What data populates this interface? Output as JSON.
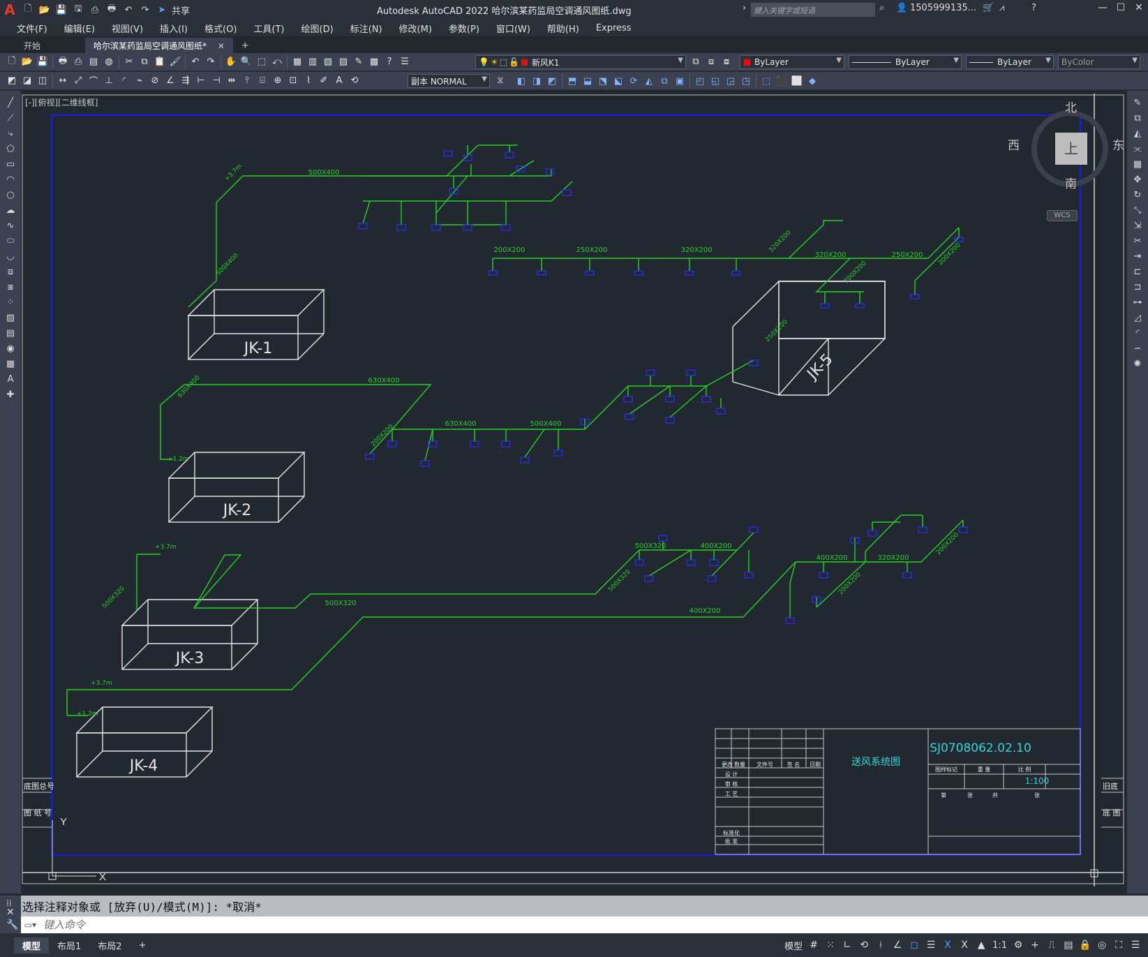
{
  "app": {
    "title": "Autodesk AutoCAD 2022    哈尔滨某药监局空调通风图纸.dwg",
    "share_label": "共享",
    "search_placeholder": "键入关键字或短语",
    "user": "1505999135...",
    "help": "?"
  },
  "menu": [
    "文件(F)",
    "编辑(E)",
    "视图(V)",
    "插入(I)",
    "格式(O)",
    "工具(T)",
    "绘图(D)",
    "标注(N)",
    "修改(M)",
    "参数(P)",
    "窗口(W)",
    "帮助(H)",
    "Express"
  ],
  "tabs": [
    {
      "label": "开始",
      "active": false
    },
    {
      "label": "哈尔滨某药监局空调通风图纸*",
      "active": true
    }
  ],
  "toolbar": {
    "layer_name": "新风K1",
    "color": "ByLayer",
    "linetype": "ByLayer",
    "lineweight": "ByLayer",
    "plotstyle": "ByColor",
    "dimstyle": "副本 NORMAL"
  },
  "viewport": {
    "label": "[-][俯视][二维线框]"
  },
  "viewcube": {
    "north": "北",
    "south": "南",
    "east": "东",
    "west": "西",
    "face": "上",
    "wcs": "WCS"
  },
  "drawing": {
    "units": [
      "JK-1",
      "JK-2",
      "JK-3",
      "JK-4",
      "JK-5"
    ],
    "duct_labels": [
      "500X400",
      "630X400",
      "500X320",
      "400X200",
      "320X200",
      "250X200",
      "200X200",
      "320X200",
      "250X200",
      "200X200",
      "200X200",
      "250X200",
      "320X200",
      "630X400",
      "500X400",
      "200X200",
      "400X200",
      "320X200",
      "500X320",
      "400X200",
      "200X200",
      "200X200"
    ],
    "elevations": [
      "+3.7m",
      "+1.2m"
    ],
    "title_block": {
      "drawing_no": "SJ0708062.02.10",
      "drawing_title": "送风系统图",
      "scale": "1:100",
      "rows": [
        "设 计",
        "审 核",
        "工 艺",
        "标准化",
        "批 准"
      ],
      "head": [
        "更改",
        "数量",
        "文件号",
        "签 名",
        "日期"
      ],
      "meta": [
        "图样标记",
        "重 量",
        "比 例"
      ],
      "pages": [
        "第",
        "张",
        "共",
        "张"
      ],
      "left_labels": [
        "底图总号",
        "图 纸 号"
      ],
      "right_labels": [
        "旧底",
        "底 图"
      ]
    }
  },
  "command": {
    "history": "选择注释对象或 [放弃(U)/模式(M)]: *取消*",
    "input_placeholder": "键入命令"
  },
  "layouts": [
    "模型",
    "布局1",
    "布局2"
  ],
  "status": {
    "mode": "模型",
    "scale": "1:1"
  },
  "colors": {
    "duct": "#22d323",
    "frame": "#1b1bd8",
    "lines": "#e6e6e6",
    "terminal": "#2b2bff",
    "title_text": "#2fd8d8",
    "background": "#212830"
  }
}
